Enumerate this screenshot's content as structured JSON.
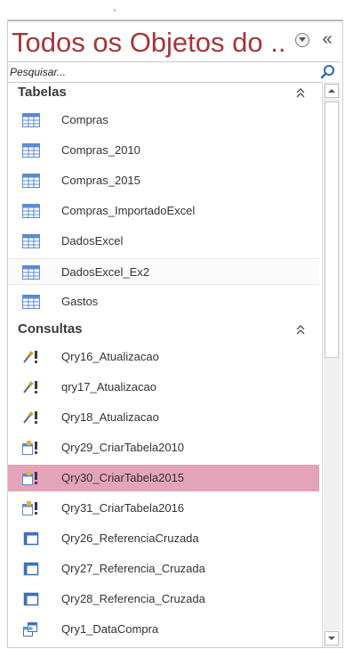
{
  "pane": {
    "title": "Todos os Objetos do ...",
    "menu_icon": "chevron-down-circle-icon",
    "collapse_label": "«",
    "search_placeholder": "Pesquisar...",
    "search_icon": "magnifier-icon"
  },
  "groups": [
    {
      "label": "Tabelas",
      "icon": "collapse-double-chevron-icon",
      "items": [
        {
          "label": "Compras",
          "icon": "table-icon"
        },
        {
          "label": "Compras_2010",
          "icon": "table-icon"
        },
        {
          "label": "Compras_2015",
          "icon": "table-icon"
        },
        {
          "label": "Compras_ImportadoExcel",
          "icon": "table-icon"
        },
        {
          "label": "DadosExcel",
          "icon": "table-icon"
        },
        {
          "label": "DadosExcel_Ex2",
          "icon": "table-icon"
        },
        {
          "label": "Gastos",
          "icon": "table-icon"
        }
      ]
    },
    {
      "label": "Consultas",
      "icon": "collapse-double-chevron-icon",
      "items": [
        {
          "label": "Qry16_Atualizacao",
          "icon": "update-query-icon"
        },
        {
          "label": "qry17_Atualizacao",
          "icon": "update-query-icon"
        },
        {
          "label": "Qry18_Atualizacao",
          "icon": "update-query-icon"
        },
        {
          "label": "Qry29_CriarTabela2010",
          "icon": "make-table-query-icon"
        },
        {
          "label": "Qry30_CriarTabela2015",
          "icon": "make-table-query-icon"
        },
        {
          "label": "Qry31_CriarTabela2016",
          "icon": "make-table-query-icon"
        },
        {
          "label": "Qry26_ReferenciaCruzada",
          "icon": "crosstab-query-icon"
        },
        {
          "label": "Qry27_Referencia_Cruzada",
          "icon": "crosstab-query-icon"
        },
        {
          "label": "Qry28_Referencia_Cruzada",
          "icon": "crosstab-query-icon"
        },
        {
          "label": "Qry1_DataCompra",
          "icon": "select-query-icon"
        }
      ]
    }
  ],
  "selected_item": "Qry30_CriarTabela2015",
  "colors": {
    "title": "#a4373a",
    "selected": "#e3a3b8"
  }
}
